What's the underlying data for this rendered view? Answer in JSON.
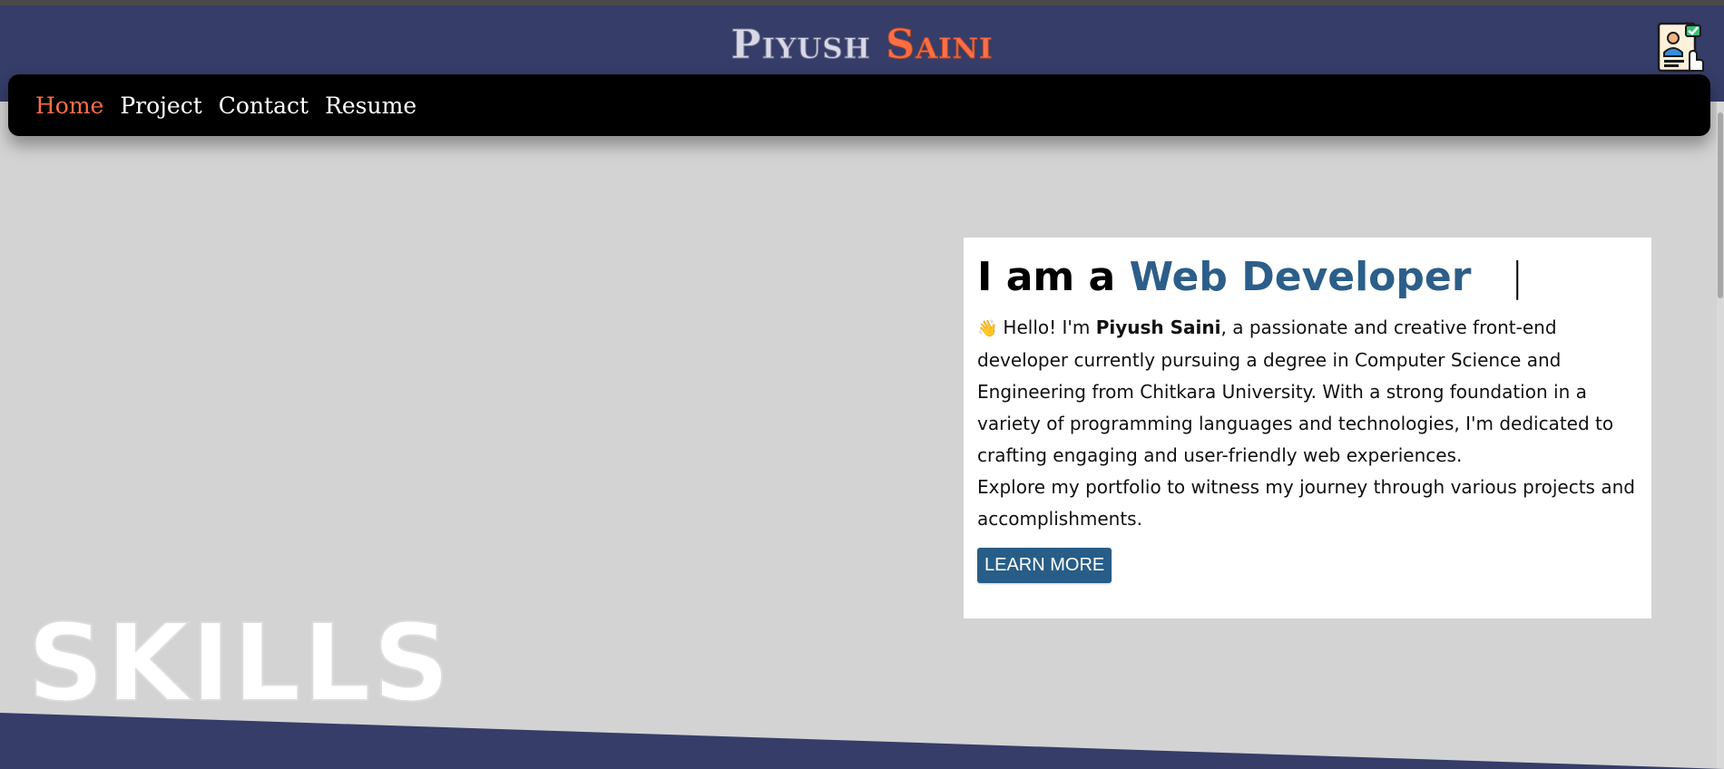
{
  "header": {
    "brand_first": "Piyush",
    "brand_last": "Saini",
    "resume_icon": "resume-document-icon"
  },
  "nav": {
    "items": [
      {
        "label": "Home",
        "active": true
      },
      {
        "label": "Project",
        "active": false
      },
      {
        "label": "Contact",
        "active": false
      },
      {
        "label": "Resume",
        "active": false
      }
    ]
  },
  "intro": {
    "heading_prefix": "I am a",
    "heading_role": "Web Developer",
    "heading_cursor": "|",
    "wave_emoji": "👋",
    "p1_before": "Hello! I'm",
    "p1_name": "Piyush Saini",
    "p1_after": ", a passionate and creative front-end developer currently pursuing a degree in Computer Science and Engineering from Chitkara University. With a strong foundation in a variety of programming languages and technologies, I'm dedicated to crafting engaging and user-friendly web experiences.",
    "p2": "Explore my portfolio to witness my journey through various projects and accomplishments.",
    "button_label": "LEARN MORE"
  },
  "skills": {
    "title": "SKILLS"
  },
  "colors": {
    "header_bg": "#353d68",
    "accent": "#ff6f45",
    "page_bg": "#d3d3d3",
    "nav_bg": "#000000",
    "role_text": "#2c5e8a",
    "button_bg": "#285d87"
  }
}
